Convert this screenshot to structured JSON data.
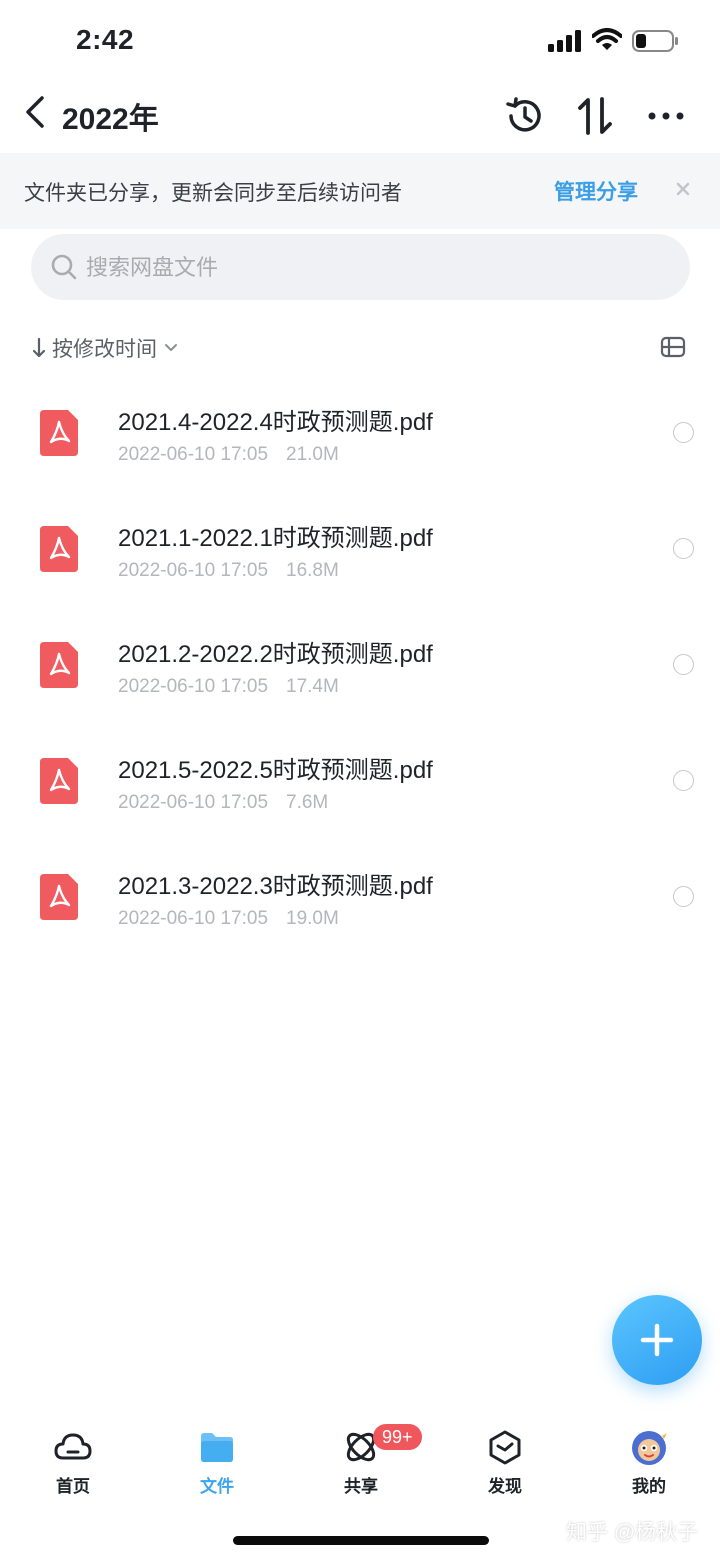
{
  "status_bar": {
    "time": "2:42"
  },
  "header": {
    "title": "2022年"
  },
  "notice": {
    "text": "文件夹已分享，更新会同步至后续访问者",
    "link": "管理分享"
  },
  "search": {
    "placeholder": "搜索网盘文件"
  },
  "sort": {
    "label": "按修改时间"
  },
  "files": [
    {
      "name": "2021.4-2022.4时政预测题.pdf",
      "date": "2022-06-10 17:05",
      "size": "21.0M"
    },
    {
      "name": "2021.1-2022.1时政预测题.pdf",
      "date": "2022-06-10 17:05",
      "size": "16.8M"
    },
    {
      "name": "2021.2-2022.2时政预测题.pdf",
      "date": "2022-06-10 17:05",
      "size": "17.4M"
    },
    {
      "name": "2021.5-2022.5时政预测题.pdf",
      "date": "2022-06-10 17:05",
      "size": "7.6M"
    },
    {
      "name": "2021.3-2022.3时政预测题.pdf",
      "date": "2022-06-10 17:05",
      "size": "19.0M"
    }
  ],
  "nav": {
    "home": "首页",
    "files": "文件",
    "share": "共享",
    "discover": "发现",
    "mine": "我的",
    "share_badge": "99+"
  },
  "watermark": "知乎 @杨秋子",
  "colors": {
    "accent": "#3aa4ee",
    "pdf": "#ef5b5f",
    "badge": "#f0575c"
  }
}
